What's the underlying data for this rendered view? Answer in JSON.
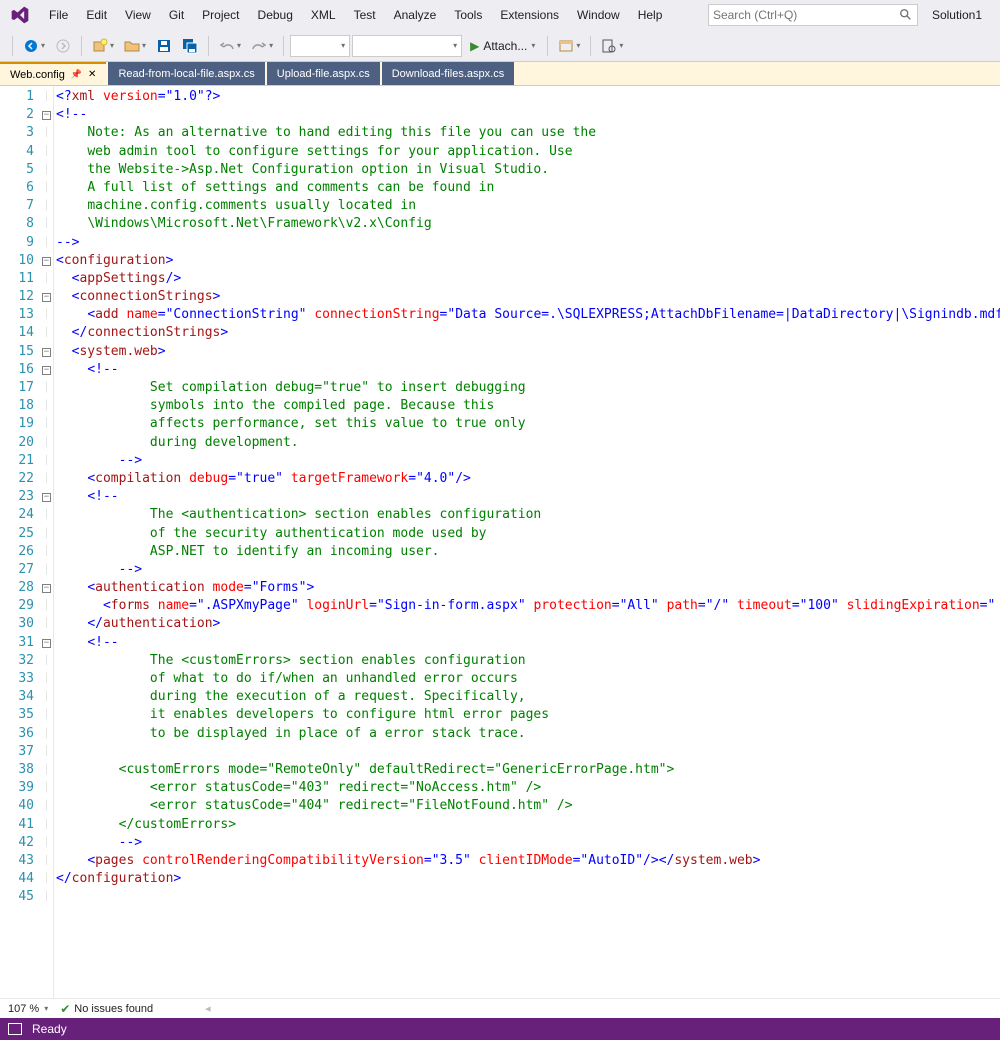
{
  "menu": [
    "File",
    "Edit",
    "View",
    "Git",
    "Project",
    "Debug",
    "XML",
    "Test",
    "Analyze",
    "Tools",
    "Extensions",
    "Window",
    "Help"
  ],
  "search": {
    "placeholder": "Search (Ctrl+Q)"
  },
  "solution": "Solution1",
  "toolbar": {
    "attach": "Attach..."
  },
  "tabs": [
    {
      "label": "Web.config",
      "active": true,
      "pinned": true
    },
    {
      "label": "Read-from-local-file.aspx.cs",
      "active": false
    },
    {
      "label": "Upload-file.aspx.cs",
      "active": false
    },
    {
      "label": "Download-files.aspx.cs",
      "active": false
    }
  ],
  "zoom": "107 %",
  "issues": "No issues found",
  "status": "Ready",
  "lines": [
    {
      "n": 1,
      "fold": "",
      "html": "<span class='c-delim'>&lt;?</span><span class='c-tag'>xml</span> <span class='c-attr'>version</span><span class='c-delim'>=</span><span class='c-val'>\"1.0\"</span><span class='c-delim'>?&gt;</span>"
    },
    {
      "n": 2,
      "fold": "-",
      "html": "<span class='c-delim'>&lt;!--</span>"
    },
    {
      "n": 3,
      "fold": "",
      "html": "    <span class='c-comment'>Note: As an alternative to hand editing this file you can use the</span>"
    },
    {
      "n": 4,
      "fold": "",
      "html": "    <span class='c-comment'>web admin tool to configure settings for your application. Use</span>"
    },
    {
      "n": 5,
      "fold": "",
      "html": "    <span class='c-comment'>the Website-&gt;Asp.Net Configuration option in Visual Studio.</span>"
    },
    {
      "n": 6,
      "fold": "",
      "html": "    <span class='c-comment'>A full list of settings and comments can be found in</span>"
    },
    {
      "n": 7,
      "fold": "",
      "html": "    <span class='c-comment'>machine.config.comments usually located in</span>"
    },
    {
      "n": 8,
      "fold": "",
      "html": "    <span class='c-comment'>\\Windows\\Microsoft.Net\\Framework\\v2.x\\Config</span>"
    },
    {
      "n": 9,
      "fold": "",
      "html": "<span class='c-delim'>--&gt;</span>"
    },
    {
      "n": 10,
      "fold": "-",
      "html": "<span class='c-delim'>&lt;</span><span class='c-tag'>configuration</span><span class='c-delim'>&gt;</span>"
    },
    {
      "n": 11,
      "fold": "",
      "html": "  <span class='c-delim'>&lt;</span><span class='c-tag'>appSettings</span><span class='c-delim'>/&gt;</span>"
    },
    {
      "n": 12,
      "fold": "-",
      "html": "  <span class='c-delim'>&lt;</span><span class='c-tag'>connectionStrings</span><span class='c-delim'>&gt;</span>"
    },
    {
      "n": 13,
      "fold": "",
      "html": "    <span class='c-delim'>&lt;</span><span class='c-tag'>add</span> <span class='c-attr'>name</span><span class='c-delim'>=</span><span class='c-val'>\"ConnectionString\"</span> <span class='c-attr'>connectionString</span><span class='c-delim'>=</span><span class='c-val'>\"Data Source=.\\SQLEXPRESS;AttachDbFilename=|DataDirectory|\\Signindb.mdf</span>"
    },
    {
      "n": 14,
      "fold": "",
      "html": "  <span class='c-delim'>&lt;/</span><span class='c-tag'>connectionStrings</span><span class='c-delim'>&gt;</span>"
    },
    {
      "n": 15,
      "fold": "-",
      "html": "  <span class='c-delim'>&lt;</span><span class='c-tag'>system.web</span><span class='c-delim'>&gt;</span>"
    },
    {
      "n": 16,
      "fold": "-",
      "html": "    <span class='c-delim'>&lt;!--</span>"
    },
    {
      "n": 17,
      "fold": "",
      "html": "            <span class='c-comment'>Set compilation debug=\"true\" to insert debugging</span>"
    },
    {
      "n": 18,
      "fold": "",
      "html": "            <span class='c-comment'>symbols into the compiled page. Because this</span>"
    },
    {
      "n": 19,
      "fold": "",
      "html": "            <span class='c-comment'>affects performance, set this value to true only</span>"
    },
    {
      "n": 20,
      "fold": "",
      "html": "            <span class='c-comment'>during development.</span>"
    },
    {
      "n": 21,
      "fold": "",
      "html": "        <span class='c-delim'>--&gt;</span>"
    },
    {
      "n": 22,
      "fold": "",
      "html": "    <span class='c-delim'>&lt;</span><span class='c-tag'>compilation</span> <span class='c-attr'>debug</span><span class='c-delim'>=</span><span class='c-val'>\"true\"</span> <span class='c-attr'>targetFramework</span><span class='c-delim'>=</span><span class='c-val'>\"4.0\"</span><span class='c-delim'>/&gt;</span>"
    },
    {
      "n": 23,
      "fold": "-",
      "html": "    <span class='c-delim'>&lt;!--</span>"
    },
    {
      "n": 24,
      "fold": "",
      "html": "            <span class='c-comment'>The &lt;authentication&gt; section enables configuration</span>"
    },
    {
      "n": 25,
      "fold": "",
      "html": "            <span class='c-comment'>of the security authentication mode used by</span>"
    },
    {
      "n": 26,
      "fold": "",
      "html": "            <span class='c-comment'>ASP.NET to identify an incoming user.</span>"
    },
    {
      "n": 27,
      "fold": "",
      "html": "        <span class='c-delim'>--&gt;</span>"
    },
    {
      "n": 28,
      "fold": "-",
      "html": "    <span class='c-delim'>&lt;</span><span class='c-tag'>authentication</span> <span class='c-attr'>mode</span><span class='c-delim'>=</span><span class='c-val'>\"Forms\"</span><span class='c-delim'>&gt;</span>"
    },
    {
      "n": 29,
      "fold": "",
      "html": "      <span class='c-delim'>&lt;</span><span class='c-tag'>forms</span> <span class='c-attr'>name</span><span class='c-delim'>=</span><span class='c-val'>\".ASPXmyPage\"</span> <span class='c-attr'>loginUrl</span><span class='c-delim'>=</span><span class='c-val'>\"Sign-in-form.aspx\"</span> <span class='c-attr'>protection</span><span class='c-delim'>=</span><span class='c-val'>\"All\"</span> <span class='c-attr'>path</span><span class='c-delim'>=</span><span class='c-val'>\"/\"</span> <span class='c-attr'>timeout</span><span class='c-delim'>=</span><span class='c-val'>\"100\"</span> <span class='c-attr'>slidingExpiration</span><span class='c-delim'>=</span><span class='c-val'>\"</span>"
    },
    {
      "n": 30,
      "fold": "",
      "html": "    <span class='c-delim'>&lt;/</span><span class='c-tag'>authentication</span><span class='c-delim'>&gt;</span>"
    },
    {
      "n": 31,
      "fold": "-",
      "html": "    <span class='c-delim'>&lt;!--</span>"
    },
    {
      "n": 32,
      "fold": "",
      "html": "            <span class='c-comment'>The &lt;customErrors&gt; section enables configuration</span>"
    },
    {
      "n": 33,
      "fold": "",
      "html": "            <span class='c-comment'>of what to do if/when an unhandled error occurs</span>"
    },
    {
      "n": 34,
      "fold": "",
      "html": "            <span class='c-comment'>during the execution of a request. Specifically,</span>"
    },
    {
      "n": 35,
      "fold": "",
      "html": "            <span class='c-comment'>it enables developers to configure html error pages</span>"
    },
    {
      "n": 36,
      "fold": "",
      "html": "            <span class='c-comment'>to be displayed in place of a error stack trace.</span>"
    },
    {
      "n": 37,
      "fold": "",
      "html": ""
    },
    {
      "n": 38,
      "fold": "",
      "html": "        <span class='c-comment'>&lt;customErrors mode=\"RemoteOnly\" defaultRedirect=\"GenericErrorPage.htm\"&gt;</span>"
    },
    {
      "n": 39,
      "fold": "",
      "html": "            <span class='c-comment'>&lt;error statusCode=\"403\" redirect=\"NoAccess.htm\" /&gt;</span>"
    },
    {
      "n": 40,
      "fold": "",
      "html": "            <span class='c-comment'>&lt;error statusCode=\"404\" redirect=\"FileNotFound.htm\" /&gt;</span>"
    },
    {
      "n": 41,
      "fold": "",
      "html": "        <span class='c-comment'>&lt;/customErrors&gt;</span>"
    },
    {
      "n": 42,
      "fold": "",
      "html": "        <span class='c-delim'>--&gt;</span>"
    },
    {
      "n": 43,
      "fold": "",
      "html": "    <span class='c-delim'>&lt;</span><span class='c-tag'>pages</span> <span class='c-attr'>controlRenderingCompatibilityVersion</span><span class='c-delim'>=</span><span class='c-val'>\"3.5\"</span> <span class='c-attr'>clientIDMode</span><span class='c-delim'>=</span><span class='c-val'>\"AutoID\"</span><span class='c-delim'>/&gt;&lt;/</span><span class='c-tag'>system.web</span><span class='c-delim'>&gt;</span>"
    },
    {
      "n": 44,
      "fold": "",
      "html": "<span class='c-delim'>&lt;/</span><span class='c-tag'>configuration</span><span class='c-delim'>&gt;</span>"
    },
    {
      "n": 45,
      "fold": "",
      "html": ""
    }
  ]
}
